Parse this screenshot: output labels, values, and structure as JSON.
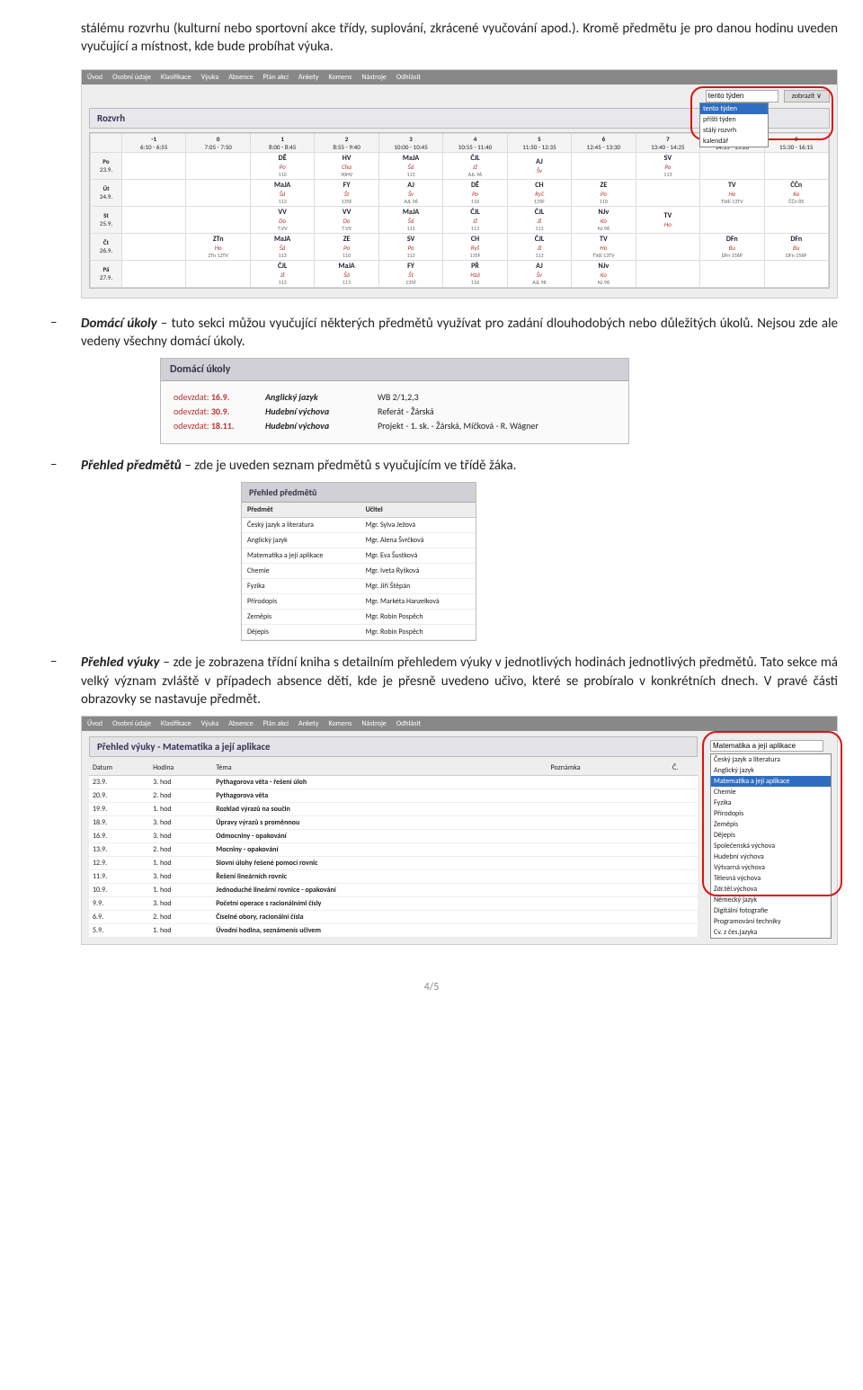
{
  "para_top": "stálému rozvrhu (kulturní nebo sportovní akce třídy, suplování, zkrácené vyučování apod.). Kromě předmětu je pro danou hodinu uveden vyučující a místnost, kde bude probíhat výuka.",
  "nav": [
    "Úvod",
    "Osobní údaje",
    "Klasifikace",
    "Výuka",
    "Absence",
    "Plán akcí",
    "Ankety",
    "Komens",
    "Nástroje",
    "Odhlásit"
  ],
  "rozvrh": {
    "title": "Rozvrh",
    "week_sel": "tento týden",
    "week_opts": [
      "tento týden",
      "příští týden",
      "stálý rozvrh",
      "kalendář"
    ],
    "zobrazit": "zobrazit  ∨",
    "head": [
      {
        "n": "-1",
        "t": "6:10 - 6:55"
      },
      {
        "n": "0",
        "t": "7:05 - 7:50"
      },
      {
        "n": "1",
        "t": "8:00 - 8:45"
      },
      {
        "n": "2",
        "t": "8:55 - 9:40"
      },
      {
        "n": "3",
        "t": "10:00 - 10:45"
      },
      {
        "n": "4",
        "t": "10:55 - 11:40"
      },
      {
        "n": "5",
        "t": "11:50 - 12:35"
      },
      {
        "n": "6",
        "t": "12:45 - 13:30"
      },
      {
        "n": "7",
        "t": "13:40 - 14:25"
      },
      {
        "n": "8",
        "t": "14:35 - 15:20"
      },
      {
        "n": "9",
        "t": "15:30 - 16:15"
      }
    ],
    "days": [
      {
        "d": "Po",
        "dt": "23.9.",
        "c": [
          "",
          "",
          "DĚ|Po|110",
          "HV|Cha|90HV",
          "MaJA|Šá|113",
          "ČJL|Jž|AJL  96",
          "AJ|Šv|",
          "",
          "SV|Po|113",
          "",
          ""
        ]
      },
      {
        "d": "Út",
        "dt": "24.9.",
        "c": [
          "",
          "",
          "MaJA|Šá|113",
          "FY|Št|135F",
          "AJ|Šv|AJL  96",
          "DĚ|Po|110",
          "CH|Ryš|135F",
          "ZE|Po|110",
          "",
          "TV|Ho|TVdí  13TV",
          "ČČn|Ko|ČČn  85"
        ]
      },
      {
        "d": "St",
        "dt": "25.9.",
        "c": [
          "",
          "",
          "VV|Do|7.VV",
          "VV|Do|7.VV",
          "MaJA|Šá|113",
          "ČJL|Jž|113",
          "ČJL|Jž|113",
          "NJv|Ko|NJ  96",
          "TV|Ho|",
          "",
          ""
        ]
      },
      {
        "d": "Čt",
        "dt": "26.9.",
        "c": [
          "",
          "ZTn|Ho|ZTn  12TV",
          "MaJA|Šá|113",
          "ZE|Po|110",
          "SV|Po|113",
          "CH|Ryš|135F",
          "ČJL|Jž|113",
          "TV|Ho|TVdí  13TV",
          "",
          "DFn|Bu|DFn  156P",
          "DFn|Bu|DFn  156P"
        ]
      },
      {
        "d": "Pá",
        "dt": "27.9.",
        "c": [
          "",
          "",
          "ČJL|Jž|113",
          "MaJA|Šá|113",
          "FY|Št|135F",
          "PŘ|Hzá|110",
          "AJ|Šv|AJL  96",
          "NJv|Ko|NJ  96",
          "",
          "",
          ""
        ]
      }
    ]
  },
  "bullet_du_head": "Domácí úkoly",
  "bullet_du_tail": " – tuto sekci můžou vyučující některých předmětů využívat pro zadání dlouhodobých nebo důležitých úkolů. Nejsou zde ale vedeny všechny domácí úkoly.",
  "du": {
    "title": "Domácí úkoly",
    "rows": [
      {
        "d": "odevzdat: ",
        "db": "16.9.",
        "p": "Anglický jazyk",
        "t": "WB 2/1,2,3"
      },
      {
        "d": "odevzdat: ",
        "db": "30.9.",
        "p": "Hudební výchova",
        "t": "Referát - Žárská"
      },
      {
        "d": "odevzdat: ",
        "db": "18.11.",
        "p": "Hudební výchova",
        "t": "Projekt - 1. sk. - Žárská, Míčková - R. Wágner"
      }
    ]
  },
  "bullet_pp_head": "Přehled předmětů",
  "bullet_pp_tail": " – zde je uveden seznam předmětů s vyučujícím ve třídě žáka.",
  "pp": {
    "title": "Přehled předmětů",
    "head": [
      "Předmět",
      "Učitel"
    ],
    "rows": [
      [
        "Český jazyk a literatura",
        "Mgr. Sylva Ježová"
      ],
      [
        "Anglický jazyk",
        "Mgr. Alena Švrčková"
      ],
      [
        "Matematika a její aplikace",
        "Mgr. Eva Šustková"
      ],
      [
        "Chemie",
        "Mgr. Iveta Ryšková"
      ],
      [
        "Fyzika",
        "Mgr. Jiří Štěpán"
      ],
      [
        "Přírodopis",
        "Mgr. Markéta Hanzelková"
      ],
      [
        "Zeměpis",
        "Mgr. Robin Pospěch"
      ],
      [
        "Dějepis",
        "Mgr. Robin Pospěch"
      ]
    ]
  },
  "bullet_pv_head": "Přehled výuky",
  "bullet_pv_tail": " – zde je zobrazena třídní kniha s detailním přehledem výuky v jednotlivých hodinách jednotlivých předmětů. Tato sekce má velký význam zvláště v případech absence dětí, kde je přesně uvedeno učivo, které se probíralo v konkrétních dnech. V pravé části obrazovky se nastavuje předmět.",
  "pv": {
    "title": "Přehled výuky - Matematika a její aplikace",
    "subj_sel": "Matematika a její aplikace",
    "subjects": [
      "Český jazyk a literatura",
      "Anglický jazyk",
      "Matematika a její aplikace",
      "Chemie",
      "Fyzika",
      "Přírodopis",
      "Zeměpis",
      "Dějepis",
      "Společenská výchova",
      "Hudební výchova",
      "Výtvarná výchova",
      "Tělesná výchova",
      "Zdr.těl.výchova",
      "Německý jazyk",
      "Digitální fotografie",
      "Programování techniky",
      "Cv. z čes.jazyka"
    ],
    "head": [
      "Datum",
      "Hodina",
      "Téma",
      "Poznámka",
      "Č."
    ],
    "rows": [
      [
        "23.9.",
        "3. hod",
        "Pythagorova věta - řešení úloh",
        "",
        ""
      ],
      [
        "20.9.",
        "2. hod",
        "Pythagorova věta",
        "",
        ""
      ],
      [
        "19.9.",
        "1. hod",
        "Rozklad výrazů na součin",
        "",
        ""
      ],
      [
        "18.9.",
        "3. hod",
        "Úpravy výrazů s proměnnou",
        "",
        ""
      ],
      [
        "16.9.",
        "3. hod",
        "Odmocniny - opakování",
        "",
        ""
      ],
      [
        "13.9.",
        "2. hod",
        "Mocniny - opakování",
        "",
        ""
      ],
      [
        "12.9.",
        "1. hod",
        "Slovní úlohy řešené pomocí rovnic",
        "",
        ""
      ],
      [
        "11.9.",
        "3. hod",
        "Řešení lineárních rovnic",
        "",
        ""
      ],
      [
        "10.9.",
        "1. hod",
        "Jednoduché lineární rovnice - opakování",
        "",
        ""
      ],
      [
        "9.9.",
        "3. hod",
        "Početní operace s racionálními čísly",
        "",
        ""
      ],
      [
        "6.9.",
        "2. hod",
        "Číselné obory, racionální čísla",
        "",
        ""
      ],
      [
        "5.9.",
        "1. hod",
        "Úvodní hodina, seznámenís učivem",
        "",
        ""
      ]
    ]
  },
  "page_number": "4/5"
}
